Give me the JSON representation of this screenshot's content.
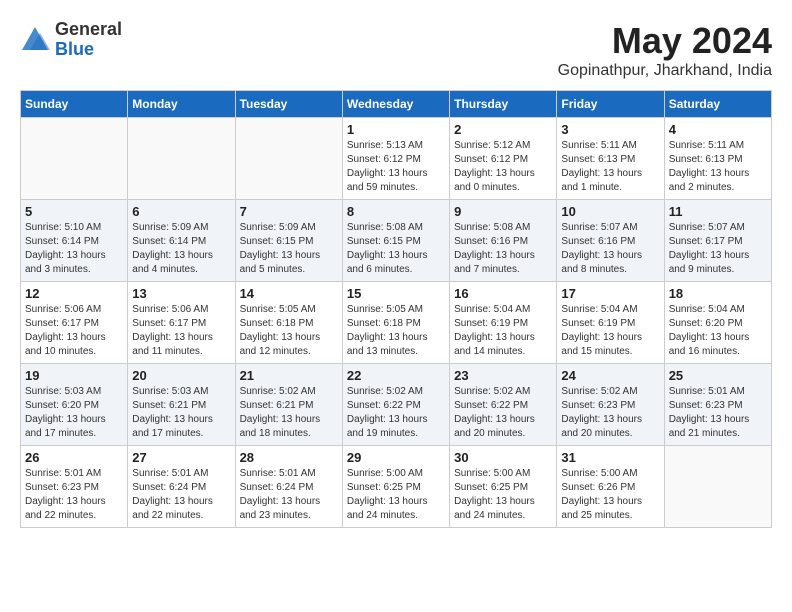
{
  "header": {
    "logo_general": "General",
    "logo_blue": "Blue",
    "title": "May 2024",
    "location": "Gopinathpur, Jharkhand, India"
  },
  "days_of_week": [
    "Sunday",
    "Monday",
    "Tuesday",
    "Wednesday",
    "Thursday",
    "Friday",
    "Saturday"
  ],
  "weeks": [
    [
      {
        "day": "",
        "sunrise": "",
        "sunset": "",
        "daylight": ""
      },
      {
        "day": "",
        "sunrise": "",
        "sunset": "",
        "daylight": ""
      },
      {
        "day": "",
        "sunrise": "",
        "sunset": "",
        "daylight": ""
      },
      {
        "day": "1",
        "sunrise": "Sunrise: 5:13 AM",
        "sunset": "Sunset: 6:12 PM",
        "daylight": "Daylight: 13 hours and 59 minutes."
      },
      {
        "day": "2",
        "sunrise": "Sunrise: 5:12 AM",
        "sunset": "Sunset: 6:12 PM",
        "daylight": "Daylight: 13 hours and 0 minutes."
      },
      {
        "day": "3",
        "sunrise": "Sunrise: 5:11 AM",
        "sunset": "Sunset: 6:13 PM",
        "daylight": "Daylight: 13 hours and 1 minute."
      },
      {
        "day": "4",
        "sunrise": "Sunrise: 5:11 AM",
        "sunset": "Sunset: 6:13 PM",
        "daylight": "Daylight: 13 hours and 2 minutes."
      }
    ],
    [
      {
        "day": "5",
        "sunrise": "Sunrise: 5:10 AM",
        "sunset": "Sunset: 6:14 PM",
        "daylight": "Daylight: 13 hours and 3 minutes."
      },
      {
        "day": "6",
        "sunrise": "Sunrise: 5:09 AM",
        "sunset": "Sunset: 6:14 PM",
        "daylight": "Daylight: 13 hours and 4 minutes."
      },
      {
        "day": "7",
        "sunrise": "Sunrise: 5:09 AM",
        "sunset": "Sunset: 6:15 PM",
        "daylight": "Daylight: 13 hours and 5 minutes."
      },
      {
        "day": "8",
        "sunrise": "Sunrise: 5:08 AM",
        "sunset": "Sunset: 6:15 PM",
        "daylight": "Daylight: 13 hours and 6 minutes."
      },
      {
        "day": "9",
        "sunrise": "Sunrise: 5:08 AM",
        "sunset": "Sunset: 6:16 PM",
        "daylight": "Daylight: 13 hours and 7 minutes."
      },
      {
        "day": "10",
        "sunrise": "Sunrise: 5:07 AM",
        "sunset": "Sunset: 6:16 PM",
        "daylight": "Daylight: 13 hours and 8 minutes."
      },
      {
        "day": "11",
        "sunrise": "Sunrise: 5:07 AM",
        "sunset": "Sunset: 6:17 PM",
        "daylight": "Daylight: 13 hours and 9 minutes."
      }
    ],
    [
      {
        "day": "12",
        "sunrise": "Sunrise: 5:06 AM",
        "sunset": "Sunset: 6:17 PM",
        "daylight": "Daylight: 13 hours and 10 minutes."
      },
      {
        "day": "13",
        "sunrise": "Sunrise: 5:06 AM",
        "sunset": "Sunset: 6:17 PM",
        "daylight": "Daylight: 13 hours and 11 minutes."
      },
      {
        "day": "14",
        "sunrise": "Sunrise: 5:05 AM",
        "sunset": "Sunset: 6:18 PM",
        "daylight": "Daylight: 13 hours and 12 minutes."
      },
      {
        "day": "15",
        "sunrise": "Sunrise: 5:05 AM",
        "sunset": "Sunset: 6:18 PM",
        "daylight": "Daylight: 13 hours and 13 minutes."
      },
      {
        "day": "16",
        "sunrise": "Sunrise: 5:04 AM",
        "sunset": "Sunset: 6:19 PM",
        "daylight": "Daylight: 13 hours and 14 minutes."
      },
      {
        "day": "17",
        "sunrise": "Sunrise: 5:04 AM",
        "sunset": "Sunset: 6:19 PM",
        "daylight": "Daylight: 13 hours and 15 minutes."
      },
      {
        "day": "18",
        "sunrise": "Sunrise: 5:04 AM",
        "sunset": "Sunset: 6:20 PM",
        "daylight": "Daylight: 13 hours and 16 minutes."
      }
    ],
    [
      {
        "day": "19",
        "sunrise": "Sunrise: 5:03 AM",
        "sunset": "Sunset: 6:20 PM",
        "daylight": "Daylight: 13 hours and 17 minutes."
      },
      {
        "day": "20",
        "sunrise": "Sunrise: 5:03 AM",
        "sunset": "Sunset: 6:21 PM",
        "daylight": "Daylight: 13 hours and 17 minutes."
      },
      {
        "day": "21",
        "sunrise": "Sunrise: 5:02 AM",
        "sunset": "Sunset: 6:21 PM",
        "daylight": "Daylight: 13 hours and 18 minutes."
      },
      {
        "day": "22",
        "sunrise": "Sunrise: 5:02 AM",
        "sunset": "Sunset: 6:22 PM",
        "daylight": "Daylight: 13 hours and 19 minutes."
      },
      {
        "day": "23",
        "sunrise": "Sunrise: 5:02 AM",
        "sunset": "Sunset: 6:22 PM",
        "daylight": "Daylight: 13 hours and 20 minutes."
      },
      {
        "day": "24",
        "sunrise": "Sunrise: 5:02 AM",
        "sunset": "Sunset: 6:23 PM",
        "daylight": "Daylight: 13 hours and 20 minutes."
      },
      {
        "day": "25",
        "sunrise": "Sunrise: 5:01 AM",
        "sunset": "Sunset: 6:23 PM",
        "daylight": "Daylight: 13 hours and 21 minutes."
      }
    ],
    [
      {
        "day": "26",
        "sunrise": "Sunrise: 5:01 AM",
        "sunset": "Sunset: 6:23 PM",
        "daylight": "Daylight: 13 hours and 22 minutes."
      },
      {
        "day": "27",
        "sunrise": "Sunrise: 5:01 AM",
        "sunset": "Sunset: 6:24 PM",
        "daylight": "Daylight: 13 hours and 22 minutes."
      },
      {
        "day": "28",
        "sunrise": "Sunrise: 5:01 AM",
        "sunset": "Sunset: 6:24 PM",
        "daylight": "Daylight: 13 hours and 23 minutes."
      },
      {
        "day": "29",
        "sunrise": "Sunrise: 5:00 AM",
        "sunset": "Sunset: 6:25 PM",
        "daylight": "Daylight: 13 hours and 24 minutes."
      },
      {
        "day": "30",
        "sunrise": "Sunrise: 5:00 AM",
        "sunset": "Sunset: 6:25 PM",
        "daylight": "Daylight: 13 hours and 24 minutes."
      },
      {
        "day": "31",
        "sunrise": "Sunrise: 5:00 AM",
        "sunset": "Sunset: 6:26 PM",
        "daylight": "Daylight: 13 hours and 25 minutes."
      },
      {
        "day": "",
        "sunrise": "",
        "sunset": "",
        "daylight": ""
      }
    ]
  ]
}
